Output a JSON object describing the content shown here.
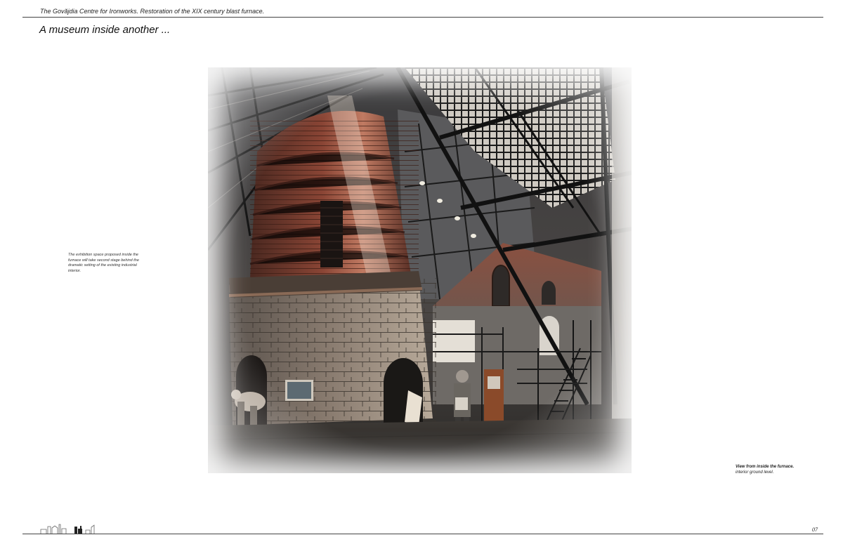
{
  "header": {
    "text": "The Govăjdia Centre for Ironworks. Restoration of the XIX century blast furnace."
  },
  "page": {
    "title": "A museum inside another ...",
    "number": "07"
  },
  "side_caption": {
    "text": "The exhibition space proposed inside the furnace will take second stage behind the dramatic setting of the existing industrial interior."
  },
  "view_caption": {
    "title": "View from inside the furnace.",
    "subtitle": "interior ground level."
  },
  "icons": {
    "logo": "industrial-skyline-logo"
  },
  "colors": {
    "brick": "#7a3a2c",
    "steel": "#1c1c1e",
    "stone": "#6c625a",
    "light": "#e9e4dc"
  }
}
